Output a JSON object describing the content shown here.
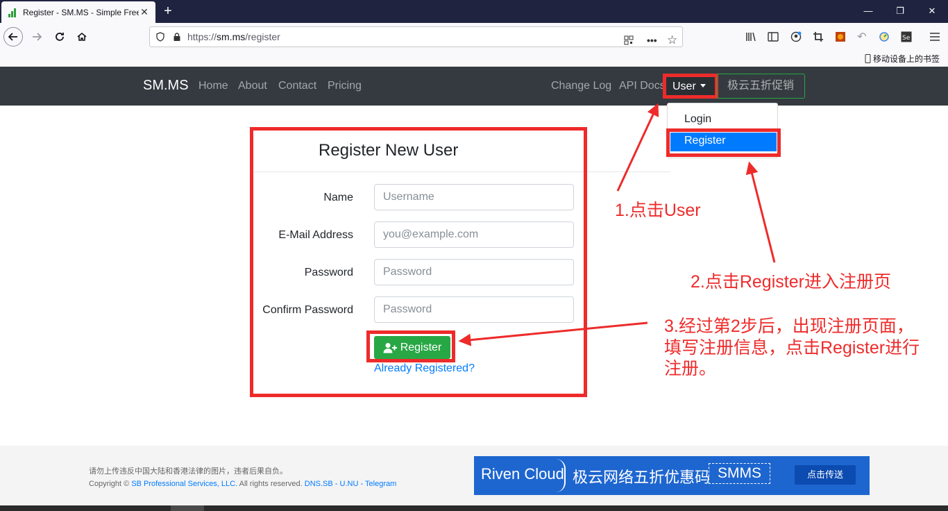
{
  "browser": {
    "tab_title": "Register - SM.MS - Simple Free",
    "new_tab": "+",
    "url_prefix": "https://",
    "url_host": "sm.ms",
    "url_path": "/register",
    "bookmarks_mobile": "移动设备上的书签",
    "window_controls": [
      "—",
      "❐",
      "✕"
    ]
  },
  "site_nav": {
    "brand": "SM.MS",
    "left_links": [
      "Home",
      "About",
      "Contact",
      "Pricing"
    ],
    "right_links": [
      "Change Log",
      "API Docs"
    ],
    "user": "User",
    "promo": "极云五折促销"
  },
  "dropdown": {
    "login": "Login",
    "register": "Register"
  },
  "form": {
    "title": "Register New User",
    "fields": [
      {
        "label": "Name",
        "placeholder": "Username"
      },
      {
        "label": "E-Mail Address",
        "placeholder": "you@example.com"
      },
      {
        "label": "Password",
        "placeholder": "Password"
      },
      {
        "label": "Confirm Password",
        "placeholder": "Password"
      }
    ],
    "submit": "Register",
    "already": "Already Registered?"
  },
  "annotations": {
    "step1": "1.点击User",
    "step2": "2.点击Register进入注册页",
    "step3_line1": "3.经过第2步后，出现注册页面，",
    "step3_line2": "填写注册信息，点击Register进行",
    "step3_line3": "注册。",
    "color": "#ee2b2b"
  },
  "footer": {
    "notice": "请勿上传违反中国大陆和香港法律的图片，违者后果自负。",
    "copyright_prefix": "Copyright ©",
    "company": "SB Professional Services, LLC.",
    "rights": "All rights reserved.",
    "link1": "DNS.SB",
    "sep1": "-",
    "link2": "U.NU",
    "sep2": "-",
    "link3": "Telegram"
  },
  "banner": {
    "brand": "Riven Cloud",
    "slogan": "极云网络五折优惠码",
    "code": "SMMS",
    "cta": "点击传送"
  },
  "colors": {
    "nav_bg": "#343a40",
    "primary": "#007bff",
    "success": "#28a745",
    "highlight": "#ee2b2b"
  }
}
